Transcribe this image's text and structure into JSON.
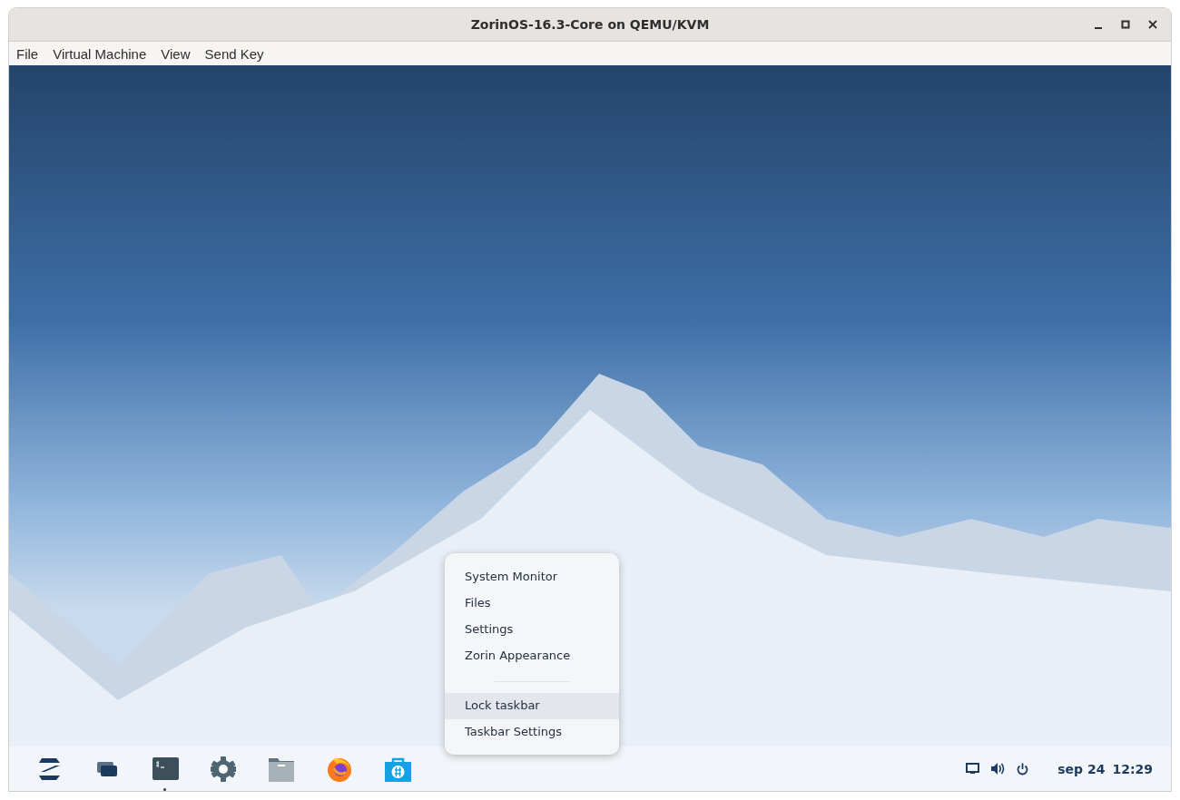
{
  "window": {
    "title": "ZorinOS-16.3-Core on QEMU/KVM"
  },
  "menu_bar": [
    "File",
    "Virtual Machine",
    "View",
    "Send Key"
  ],
  "context_menu": [
    {
      "kind": "item",
      "label": "System Monitor",
      "selected": false
    },
    {
      "kind": "item",
      "label": "Files",
      "selected": false
    },
    {
      "kind": "item",
      "label": "Settings",
      "selected": false
    },
    {
      "kind": "item",
      "label": "Zorin Appearance",
      "selected": false
    },
    {
      "kind": "separator"
    },
    {
      "kind": "item",
      "label": "Lock taskbar",
      "selected": true
    },
    {
      "kind": "item",
      "label": "Taskbar Settings",
      "selected": false
    }
  ],
  "taskbar": {
    "apps": [
      {
        "kind": "start",
        "running": false
      },
      {
        "kind": "windows",
        "running": false
      },
      {
        "kind": "terminal",
        "running": true
      },
      {
        "kind": "settings",
        "running": false
      },
      {
        "kind": "files",
        "running": false
      },
      {
        "kind": "browser",
        "running": false
      },
      {
        "kind": "store",
        "running": false
      }
    ],
    "tray": [
      {
        "kind": "display"
      },
      {
        "kind": "volume"
      },
      {
        "kind": "power"
      }
    ],
    "date": "sep 24",
    "time": "12:29"
  }
}
